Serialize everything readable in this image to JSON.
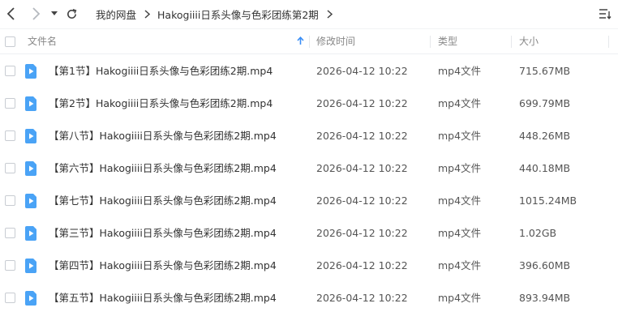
{
  "toolbar": {
    "breadcrumb": [
      "我的网盘",
      "Hakogiiii日系头像与色彩团练第2期"
    ]
  },
  "columns": {
    "name": "文件名",
    "time": "修改时间",
    "type": "类型",
    "size": "大小"
  },
  "files": [
    {
      "name": "【第1节】Hakogiiii日系头像与色彩团练2期.mp4",
      "time": "2026-04-12 10:22",
      "type": "mp4文件",
      "size": "715.67MB"
    },
    {
      "name": "【第2节】Hakogiiii日系头像与色彩团练2期.mp4",
      "time": "2026-04-12 10:22",
      "type": "mp4文件",
      "size": "699.79MB"
    },
    {
      "name": "【第八节】Hakogiiii日系头像与色彩团练2期.mp4",
      "time": "2026-04-12 10:22",
      "type": "mp4文件",
      "size": "448.26MB"
    },
    {
      "name": "【第六节】Hakogiiii日系头像与色彩团练2期.mp4",
      "time": "2026-04-12 10:22",
      "type": "mp4文件",
      "size": "440.18MB"
    },
    {
      "name": "【第七节】Hakogiiii日系头像与色彩团练2期.mp4",
      "time": "2026-04-12 10:22",
      "type": "mp4文件",
      "size": "1015.24MB"
    },
    {
      "name": "【第三节】Hakogiiii日系头像与色彩团练2期.mp4",
      "time": "2026-04-12 10:22",
      "type": "mp4文件",
      "size": "1.02GB"
    },
    {
      "name": "【第四节】Hakogiiii日系头像与色彩团练2期.mp4",
      "time": "2026-04-12 10:22",
      "type": "mp4文件",
      "size": "396.60MB"
    },
    {
      "name": "【第五节】Hakogiiii日系头像与色彩团练2期.mp4",
      "time": "2026-04-12 10:22",
      "type": "mp4文件",
      "size": "893.94MB"
    }
  ],
  "icons": {
    "back": "chevron-left-icon",
    "forward": "chevron-right-icon",
    "history": "caret-down-icon",
    "refresh": "refresh-icon",
    "sort": "sort-list-icon",
    "file": "video-file-icon"
  },
  "colors": {
    "accent": "#3a8ef6",
    "file_icon": "#4aa3f6"
  }
}
